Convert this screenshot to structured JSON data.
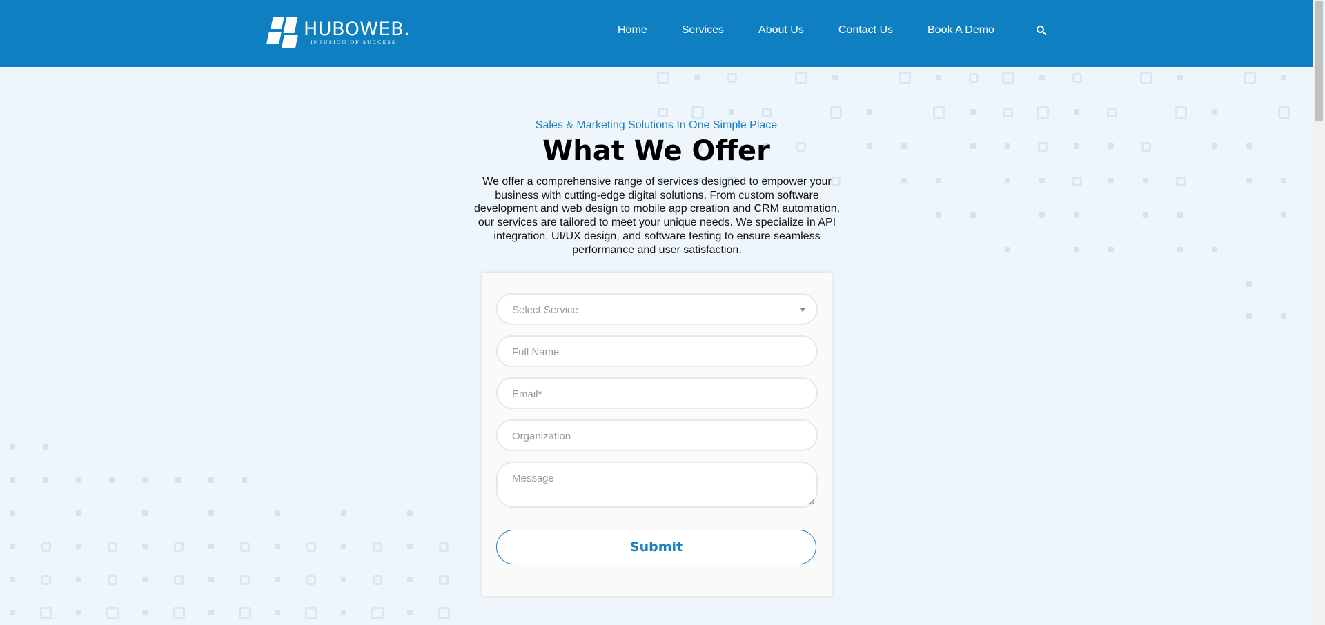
{
  "header": {
    "logo_name": "HUBOWEB.",
    "logo_tagline": "INFUSION OF SUCCESS",
    "nav": [
      "Home",
      "Services",
      "About Us",
      "Contact Us",
      "Book A Demo"
    ]
  },
  "hero": {
    "eyebrow": "Sales & Marketing Solutions In One Simple Place",
    "title": "What We Offer",
    "description": "We offer a comprehensive range of services designed to empower your business with cutting-edge digital solutions. From custom software development and web design to mobile app creation and CRM automation, our services are tailored to meet your unique needs. We specialize in API integration, UI/UX design, and software testing to ensure seamless performance and user satisfaction."
  },
  "form": {
    "service_placeholder": "Select Service",
    "name_placeholder": "Full Name",
    "email_placeholder": "Email*",
    "organization_placeholder": "Organization",
    "message_placeholder": "Message",
    "submit_label": "Submit"
  },
  "colors": {
    "brand": "#0e7fc1",
    "accent": "#1a7fc0",
    "background": "#eef6fb"
  }
}
